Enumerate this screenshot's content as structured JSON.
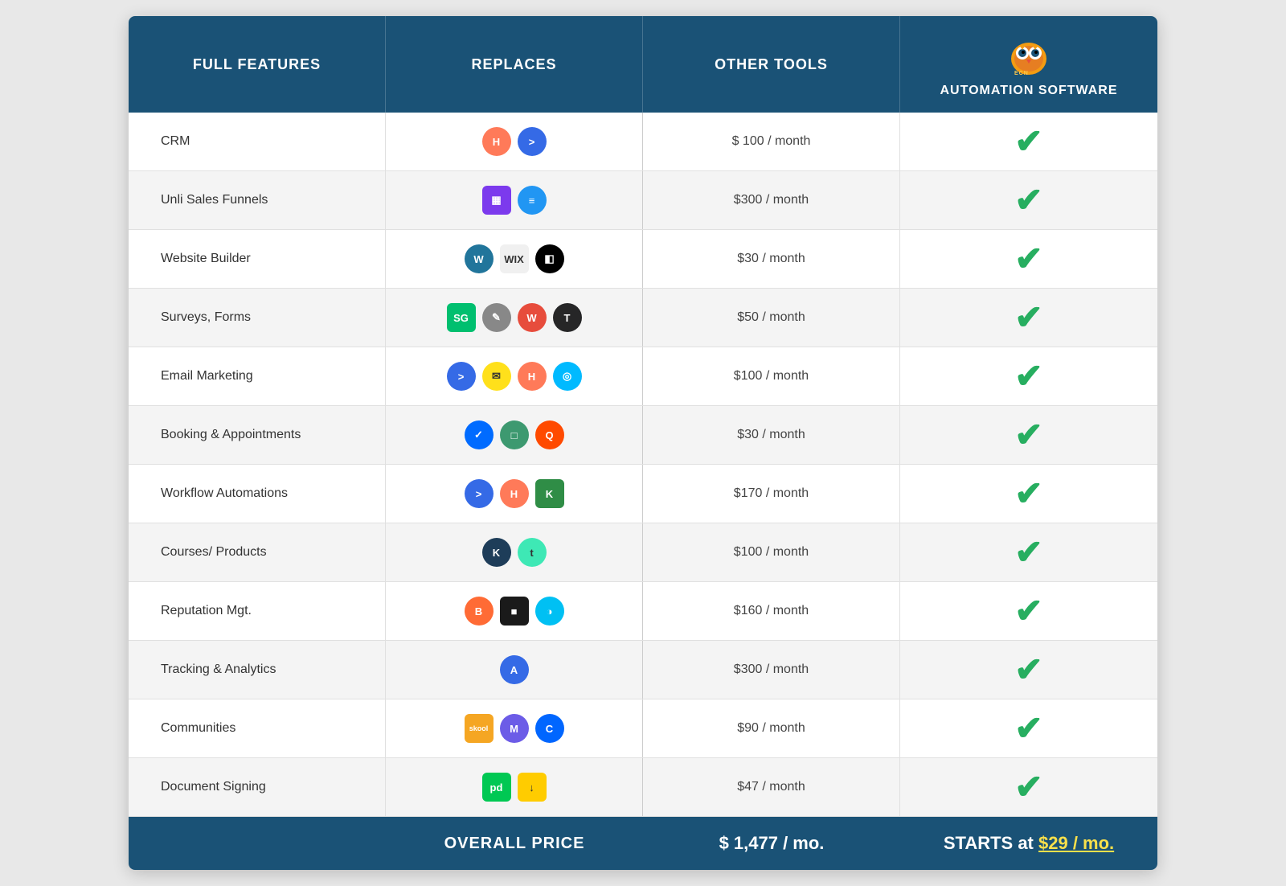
{
  "header": {
    "col1": "FULL FEATURES",
    "col2": "REPLACES",
    "col3": "OTHER TOOLS",
    "col4_line1": "AUTOMATION SOFTWARE",
    "brand": "ECN"
  },
  "rows": [
    {
      "feature": "CRM",
      "logos": [
        {
          "label": "H",
          "bg": "#ff7a59",
          "shape": "circle"
        },
        {
          "label": ">",
          "bg": "#356ae6",
          "shape": "circle"
        }
      ],
      "price": "$ 100 / month"
    },
    {
      "feature": "Unli Sales Funnels",
      "logos": [
        {
          "label": "▦",
          "bg": "#7c3aed",
          "shape": "square"
        },
        {
          "label": "≡",
          "bg": "#2196f3",
          "shape": "circle"
        }
      ],
      "price": "$300 / month"
    },
    {
      "feature": "Website Builder",
      "logos": [
        {
          "label": "W",
          "bg": "#21759b",
          "shape": "circle"
        },
        {
          "label": "WIX",
          "bg": "#f0f0f0",
          "color": "#333",
          "shape": "square"
        },
        {
          "label": "◧",
          "bg": "#000",
          "shape": "circle"
        }
      ],
      "price": "$30 / month"
    },
    {
      "feature": "Surveys, Forms",
      "logos": [
        {
          "label": "SG",
          "bg": "#00bf6f",
          "shape": "square"
        },
        {
          "label": "✎",
          "bg": "#888",
          "shape": "circle"
        },
        {
          "label": "W",
          "bg": "#e74c3c",
          "shape": "circle"
        },
        {
          "label": "T",
          "bg": "#262627",
          "shape": "circle"
        }
      ],
      "price": "$50 / month"
    },
    {
      "feature": "Email Marketing",
      "logos": [
        {
          "label": ">",
          "bg": "#356ae6",
          "shape": "circle"
        },
        {
          "label": "✉",
          "bg": "#ffe01b",
          "color": "#333",
          "shape": "circle"
        },
        {
          "label": "H",
          "bg": "#ff7a59",
          "shape": "circle"
        },
        {
          "label": "◎",
          "bg": "#00baff",
          "shape": "circle"
        }
      ],
      "price": "$100 / month"
    },
    {
      "feature": "Booking & Appointments",
      "logos": [
        {
          "label": "✓",
          "bg": "#006bff",
          "shape": "circle"
        },
        {
          "label": "□",
          "bg": "#3d9970",
          "shape": "circle"
        },
        {
          "label": "Q",
          "bg": "#ff4a00",
          "shape": "circle"
        }
      ],
      "price": "$30 / month"
    },
    {
      "feature": "Workflow Automations",
      "logos": [
        {
          "label": ">",
          "bg": "#356ae6",
          "shape": "circle"
        },
        {
          "label": "H",
          "bg": "#ff7a59",
          "shape": "circle"
        },
        {
          "label": "K",
          "bg": "#2f8d46",
          "shape": "square"
        }
      ],
      "price": "$170 / month"
    },
    {
      "feature": "Courses/ Products",
      "logos": [
        {
          "label": "K",
          "bg": "#1e3d59",
          "shape": "circle"
        },
        {
          "label": "t",
          "bg": "#3ee8b5",
          "color": "#333",
          "shape": "circle"
        }
      ],
      "price": "$100 / month"
    },
    {
      "feature": "Reputation Mgt.",
      "logos": [
        {
          "label": "B",
          "bg": "#ff6b35",
          "shape": "circle"
        },
        {
          "label": "■",
          "bg": "#1a1a1a",
          "shape": "square"
        },
        {
          "label": "◑",
          "bg": "#00c0f3",
          "shape": "circle"
        }
      ],
      "price": "$160 / month"
    },
    {
      "feature": "Tracking & Analytics",
      "logos": [
        {
          "label": "A",
          "bg": "#356ae6",
          "shape": "circle"
        }
      ],
      "price": "$300 / month"
    },
    {
      "feature": "Communities",
      "logos": [
        {
          "label": "skool",
          "bg": "#f5a623",
          "shape": "square",
          "small": true
        },
        {
          "label": "M",
          "bg": "#6c5ce7",
          "shape": "circle"
        },
        {
          "label": "C",
          "bg": "#0066ff",
          "shape": "circle"
        }
      ],
      "price": "$90 / month"
    },
    {
      "feature": "Document Signing",
      "logos": [
        {
          "label": "pd",
          "bg": "#00c853",
          "shape": "square"
        },
        {
          "label": "↓",
          "bg": "#ffcc00",
          "color": "#333",
          "shape": "square"
        }
      ],
      "price": "$47 / month"
    }
  ],
  "footer": {
    "overall_label": "OVERALL PRICE",
    "overall_price": "$ 1,477 / mo.",
    "starts_text": "STARTS  at ",
    "starts_price": "$29 / mo."
  }
}
